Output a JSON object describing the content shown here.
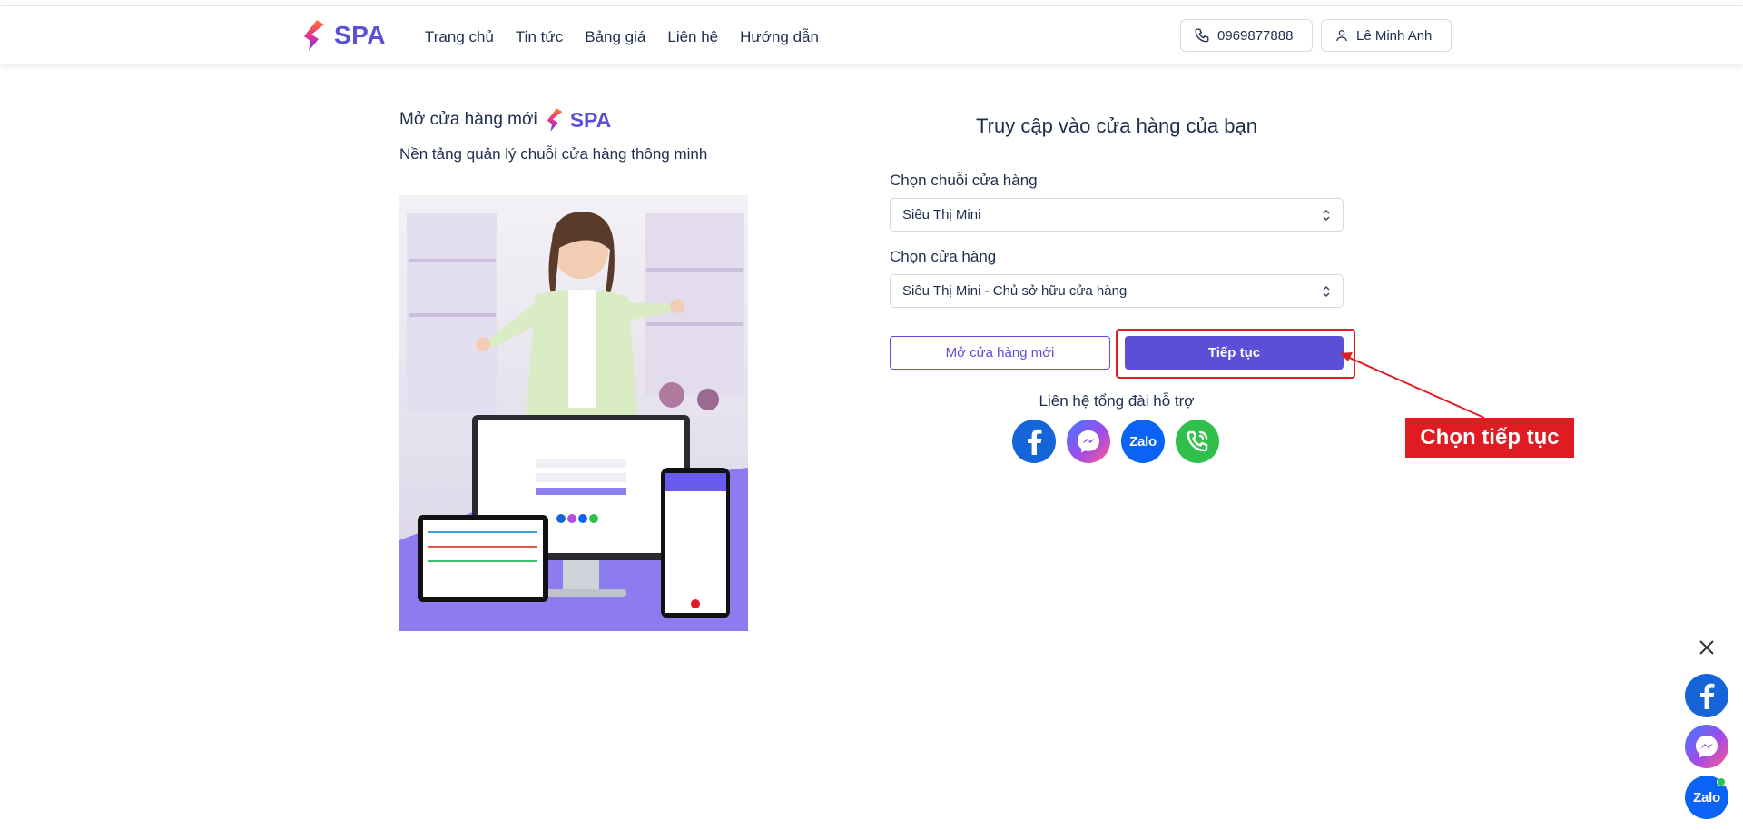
{
  "header": {
    "logo_text": "SPA",
    "nav": [
      "Trang chủ",
      "Tin tức",
      "Bảng giá",
      "Liên hệ",
      "Hướng dẫn"
    ],
    "phone": "0969877888",
    "user_name": "Lê Minh Anh"
  },
  "promo": {
    "title": "Mở cửa hàng mới",
    "logo_text": "SPA",
    "subtitle": "Nền tảng quản lý chuỗi cửa hàng thông minh"
  },
  "form": {
    "title": "Truy cập vào cửa hàng của bạn",
    "chain_label": "Chọn chuỗi cửa hàng",
    "chain_value": "Siêu Thị Mini",
    "store_label": "Chọn cửa hàng",
    "store_value": "Siêu Thị Mini - Chủ sở hữu cửa hàng",
    "new_store_button": "Mở cửa hàng mới",
    "continue_button": "Tiếp tục",
    "support_label": "Liên hệ tổng đài hỗ trợ",
    "zalo_text": "Zalo"
  },
  "annotation": {
    "label": "Chọn tiếp tục"
  },
  "floating": {
    "zalo_text": "Zalo"
  },
  "colors": {
    "brand": "#5b4fd6",
    "facebook": "#1565d8",
    "zalo": "#0b63f6",
    "phone": "#2fbf4a",
    "annotation": "#e01b22"
  }
}
